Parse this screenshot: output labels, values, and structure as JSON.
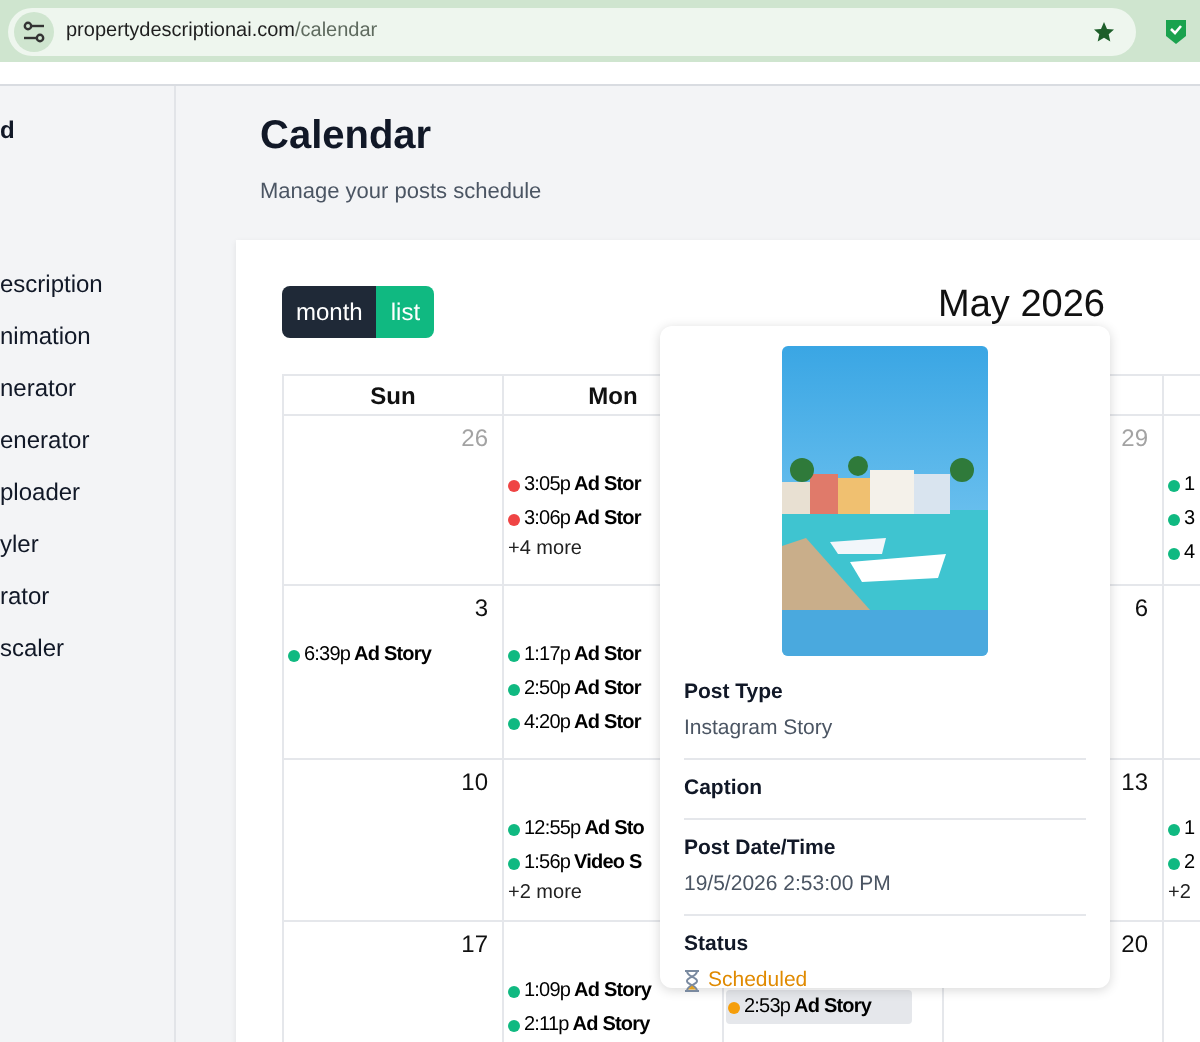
{
  "browser": {
    "host": "propertydescriptionai.com",
    "path": "/calendar"
  },
  "sidebar": {
    "items": [
      {
        "label": "d",
        "bold": true
      },
      {
        "label": "escription",
        "bold": false
      },
      {
        "label": "nimation",
        "bold": false
      },
      {
        "label": "nerator",
        "bold": false
      },
      {
        "label": "enerator",
        "bold": false
      },
      {
        "label": "ploader",
        "bold": false
      },
      {
        "label": "yler",
        "bold": false
      },
      {
        "label": "rator",
        "bold": false
      },
      {
        "label": "scaler",
        "bold": false
      }
    ]
  },
  "page": {
    "title": "Calendar",
    "subtitle": "Manage your posts schedule"
  },
  "view_toggle": [
    {
      "label": "month",
      "selected": true
    },
    {
      "label": "list",
      "selected": false
    }
  ],
  "calendar": {
    "month": "May 2026",
    "headers": {
      "sun": "Sun",
      "mon": "Mon"
    },
    "weeks": [
      {
        "sun": {
          "day": "26",
          "muted": true
        },
        "mon": {
          "events": [
            {
              "time": "3:05p",
              "title": "Ad Stor",
              "color": "#ef4444",
              "selected": false
            },
            {
              "time": "3:06p",
              "title": "Ad Stor",
              "color": "#ef4444",
              "selected": false
            }
          ],
          "more": "+4 more"
        },
        "wed": {
          "day": "29",
          "muted": true
        },
        "thu": {
          "events": [
            {
              "time": "1",
              "color": "#10b981",
              "selected": false
            },
            {
              "time": "3",
              "color": "#10b981",
              "selected": false
            },
            {
              "time": "4",
              "color": "#10b981",
              "selected": false
            }
          ]
        }
      },
      {
        "sun": {
          "day": "3",
          "muted": false,
          "events": [
            {
              "time": "6:39p",
              "title": "Ad Story",
              "color": "#10b981",
              "selected": false
            }
          ]
        },
        "mon": {
          "events": [
            {
              "time": "1:17p",
              "title": "Ad Stor",
              "color": "#10b981",
              "selected": false
            },
            {
              "time": "2:50p",
              "title": "Ad Stor",
              "color": "#10b981",
              "selected": false
            },
            {
              "time": "4:20p",
              "title": "Ad Stor",
              "color": "#10b981",
              "selected": false
            }
          ]
        },
        "wed": {
          "day": "6",
          "muted": false
        }
      },
      {
        "sun": {
          "day": "10",
          "muted": false
        },
        "mon": {
          "events": [
            {
              "time": "12:55p",
              "title": "Ad Sto",
              "color": "#10b981",
              "selected": false
            },
            {
              "time": "1:56p",
              "title": "Video S",
              "color": "#10b981",
              "selected": false
            }
          ],
          "more": "+2 more"
        },
        "wed": {
          "day": "13",
          "muted": false
        },
        "thu": {
          "events": [
            {
              "time": "1",
              "color": "#10b981",
              "selected": false
            },
            {
              "time": "2",
              "color": "#10b981",
              "selected": false
            }
          ],
          "more": "+2"
        }
      },
      {
        "sun": {
          "day": "17",
          "muted": false
        },
        "mon": {
          "events": [
            {
              "time": "1:09p",
              "title": "Ad Story",
              "color": "#10b981",
              "selected": false
            },
            {
              "time": "2:11p",
              "title": "Ad Story",
              "color": "#10b981",
              "selected": false
            }
          ]
        },
        "tue": {
          "events": [
            {
              "time": "2:53p",
              "title": "Ad Story",
              "color": "#f59e0b",
              "selected": true
            }
          ]
        },
        "wed": {
          "day": "20",
          "muted": false
        }
      }
    ]
  },
  "popover": {
    "fields": [
      {
        "label": "Post Type",
        "value": "Instagram Story"
      },
      {
        "label": "Caption"
      },
      {
        "label": "Post Date/Time",
        "value": "19/5/2026 2:53:00 PM"
      }
    ],
    "status": {
      "label": "Status",
      "value": "Scheduled",
      "kind": "scheduled"
    }
  }
}
